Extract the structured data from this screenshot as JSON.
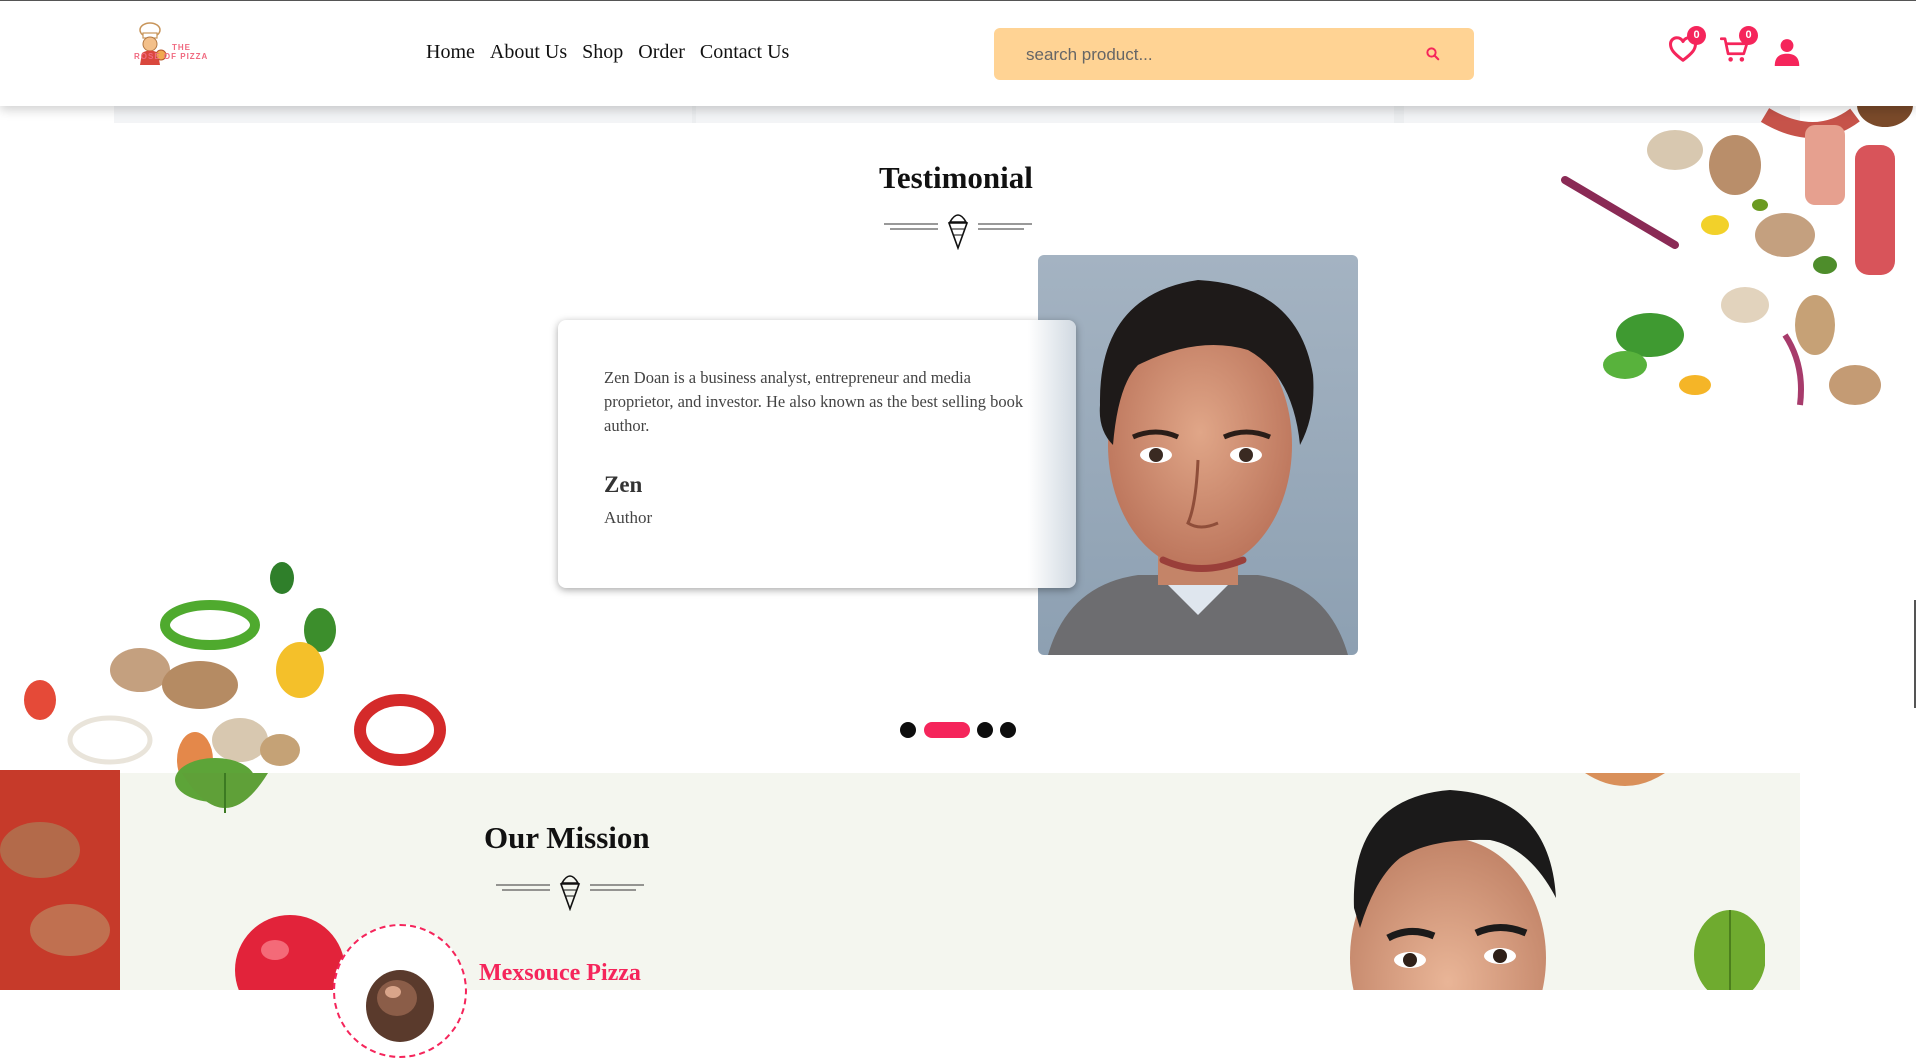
{
  "header": {
    "logo_text_line1": "THE",
    "logo_text_line2": "ROSE OF PIZZA",
    "nav": [
      "Home",
      "About Us",
      "Shop",
      "Order",
      "Contact Us"
    ],
    "search_placeholder": "search product...",
    "wishlist_count": "0",
    "cart_count": "0"
  },
  "testimonial": {
    "title": "Testimonial",
    "quote": "Zen Doan is a business analyst, entrepreneur and media proprietor, and investor. He also known as the best selling book author.",
    "author_name": "Zen",
    "author_role": "Author",
    "slider_dots": 4,
    "active_dot": 2
  },
  "mission": {
    "title": "Our Mission",
    "item_name": "Mexsouce Pizza"
  },
  "colors": {
    "accent": "#f5255b",
    "search_bg": "#ffd394",
    "mission_bg": "#f4f6ef"
  },
  "icons": [
    "search-icon",
    "heart-icon",
    "cart-icon",
    "user-icon",
    "ice-cream-icon"
  ]
}
